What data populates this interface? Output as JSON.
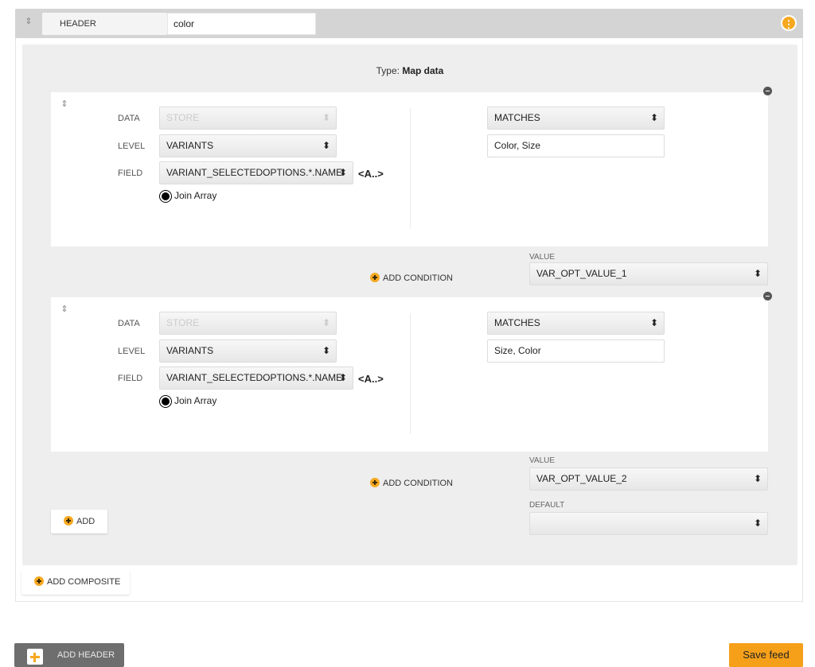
{
  "header": {
    "label": "HEADER",
    "input_value": "color",
    "menu_glyph": "⋮"
  },
  "panel": {
    "type_prefix": "Type:",
    "type_value": "Map data"
  },
  "conditions": [
    {
      "data_label": "DATA",
      "data_value": "STORE",
      "level_label": "LEVEL",
      "level_value": "VARIANTS",
      "field_label": "FIELD",
      "field_value": "VARIANT_SELECTEDOPTIONS.*.NAME",
      "ab_label": "<A..>",
      "join_label": "Join Array",
      "operator": "MATCHES",
      "match_value": "Color, Size",
      "add_condition": "ADD CONDITION",
      "value_label": "VALUE",
      "value": "VAR_OPT_VALUE_1"
    },
    {
      "data_label": "DATA",
      "data_value": "STORE",
      "level_label": "LEVEL",
      "level_value": "VARIANTS",
      "field_label": "FIELD",
      "field_value": "VARIANT_SELECTEDOPTIONS.*.NAME",
      "ab_label": "<A..>",
      "join_label": "Join Array",
      "operator": "MATCHES",
      "match_value": "Size, Color",
      "add_condition": "ADD CONDITION",
      "value_label": "VALUE",
      "value": "VAR_OPT_VALUE_2"
    }
  ],
  "default": {
    "label": "DEFAULT",
    "value": ""
  },
  "buttons": {
    "add": "ADD",
    "add_composite": "ADD COMPOSITE",
    "add_header": "ADD HEADER",
    "save_feed": "Save feed"
  },
  "glyphs": {
    "drag": "⇕",
    "select_arrows": "⬍"
  },
  "colors": {
    "accent": "#f6a821",
    "panel_bg": "#eeeeee",
    "header_bg": "#d4d4d4",
    "add_header_bg": "#6e6e6e",
    "save_bg": "#f6a01a"
  }
}
